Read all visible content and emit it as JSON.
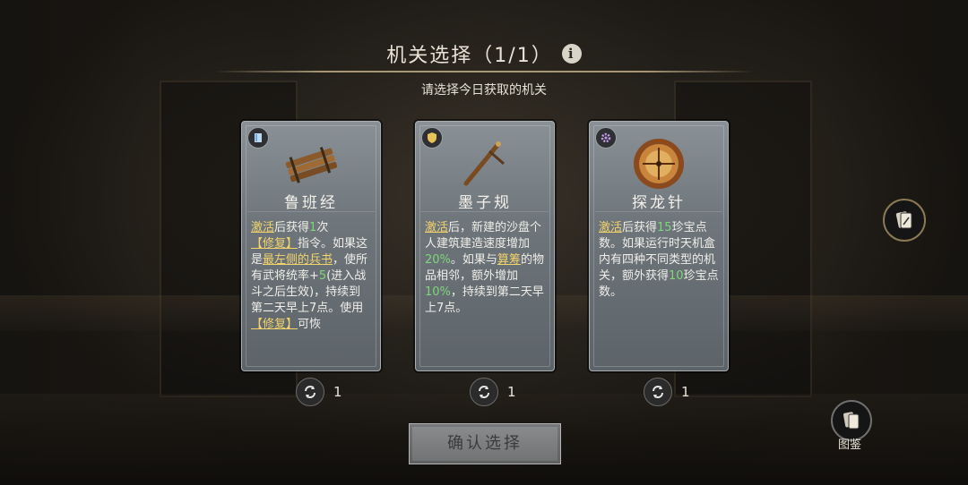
{
  "header": {
    "title": "机关选择（1/1）",
    "subtitle": "请选择今日获取的机关"
  },
  "cards": [
    {
      "name": "鲁班经",
      "badge_icon": "book-badge-icon",
      "art_icon": "bamboo-scroll-icon",
      "desc": [
        {
          "t": "激活",
          "c": "hl-u"
        },
        {
          "t": "后获得",
          "c": ""
        },
        {
          "t": "1",
          "c": "hl-g"
        },
        {
          "t": "次",
          "c": ""
        },
        {
          "t": "【修复】",
          "c": "hl-u"
        },
        {
          "t": "指令。如果这是",
          "c": ""
        },
        {
          "t": "最左侧的兵书",
          "c": "hl-u"
        },
        {
          "t": "，使所有武将统率+",
          "c": ""
        },
        {
          "t": "5",
          "c": "hl-g"
        },
        {
          "t": "(进入战斗之后生效)，持续到第二天早上7点。使用",
          "c": ""
        },
        {
          "t": "【修复】",
          "c": "hl-u"
        },
        {
          "t": "可恢",
          "c": ""
        }
      ],
      "reroll_count": "1"
    },
    {
      "name": "墨子规",
      "badge_icon": "shield-badge-icon",
      "art_icon": "carpenter-square-icon",
      "desc": [
        {
          "t": "激活",
          "c": "hl-u"
        },
        {
          "t": "后，新建的沙盘个人建筑建造速度增加",
          "c": ""
        },
        {
          "t": "20%",
          "c": "hl-g"
        },
        {
          "t": "。如果与",
          "c": ""
        },
        {
          "t": "算筹",
          "c": "hl-u"
        },
        {
          "t": "的物品相邻，额外增加",
          "c": ""
        },
        {
          "t": "10%",
          "c": "hl-g"
        },
        {
          "t": "，持续到第二天早上7点。",
          "c": ""
        }
      ],
      "reroll_count": "1"
    },
    {
      "name": "探龙针",
      "badge_icon": "gear-badge-icon",
      "art_icon": "compass-icon",
      "desc": [
        {
          "t": "激活",
          "c": "hl-u"
        },
        {
          "t": "后获得",
          "c": ""
        },
        {
          "t": "15",
          "c": "hl-g"
        },
        {
          "t": "珍宝点数。如果运行时天机盒内有四种不同类型的机关，额外获得",
          "c": ""
        },
        {
          "t": "10",
          "c": "hl-g"
        },
        {
          "t": "珍宝点数。",
          "c": ""
        }
      ],
      "reroll_count": "1"
    }
  ],
  "confirm_label": "确认选择",
  "atlas_label": "图鉴",
  "colors": {
    "highlight_yellow": "#f2d36b",
    "highlight_green": "#7fd67a",
    "card_bg": "#6e767c"
  }
}
